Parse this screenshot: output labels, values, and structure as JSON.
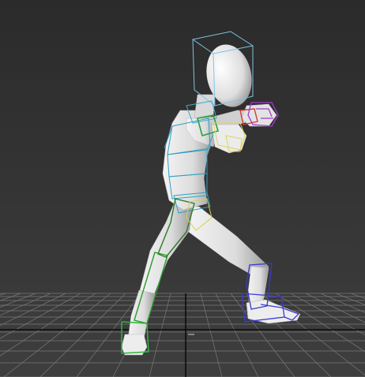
{
  "viewport": {
    "background_top": "#2b2b2b",
    "background_bottom": "#3e3e3e",
    "grid_color": "#7a7a7a",
    "grid_axis_color": "#0b0b0b",
    "mesh_color": "#e8e8e8"
  },
  "character": {
    "bones": [
      {
        "name": "head",
        "color": "#6fb6d8"
      },
      {
        "name": "neck",
        "color": "#41a9c9"
      },
      {
        "name": "spine",
        "color": "#2f9fc2"
      },
      {
        "name": "pelvis",
        "color": "#2f9fc2"
      },
      {
        "name": "right-upper-arm",
        "color": "#23a33a"
      },
      {
        "name": "right-forearm",
        "color": "#e1d35c"
      },
      {
        "name": "right-hand",
        "color": "#e1d35c"
      },
      {
        "name": "left-forearm",
        "color": "#d33a3a"
      },
      {
        "name": "left-hand",
        "color": "#a03ad0"
      },
      {
        "name": "left-thigh",
        "color": "#2a7c2a"
      },
      {
        "name": "left-calf",
        "color": "#2a9a2a"
      },
      {
        "name": "left-foot",
        "color": "#2fb33f"
      },
      {
        "name": "right-thigh",
        "color": "#d8d050"
      },
      {
        "name": "right-calf",
        "color": "#3a3ac8"
      },
      {
        "name": "right-foot",
        "color": "#3b3bd8"
      }
    ]
  }
}
